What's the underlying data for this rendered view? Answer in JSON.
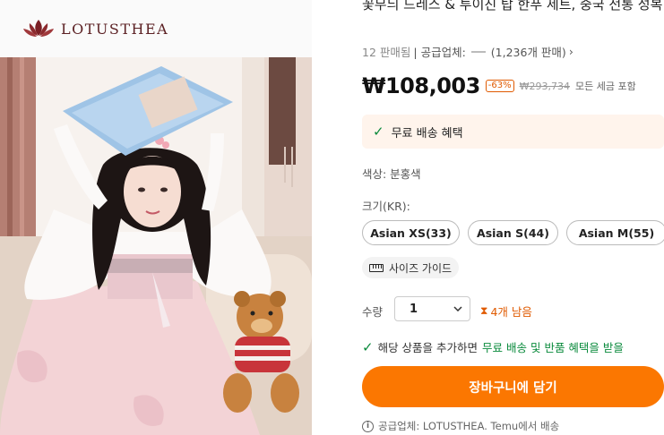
{
  "brand": {
    "name": "LOTUSTHEA"
  },
  "product": {
    "title": "꽃무늬 드레스 & 투이진 탑 한푸 세트, 중국 전통 성복",
    "sold": "12 판매됨",
    "supplier_prefix": "| 공급업체:",
    "supplier_count": "(1,236개 판매)",
    "price": "₩108,003",
    "discount": "-63%",
    "original_price": "₩293,734",
    "tax_note": "모든 세금 포함",
    "shipping_benefit": "무료 배송 혜택",
    "color": "색상: 분홍색",
    "size_label": "크기(KR):",
    "sizes": [
      "Asian XS(33)",
      "Asian S(44)",
      "Asian M(55)"
    ],
    "size_guide": "사이즈 가이드",
    "qty_label": "수량",
    "qty_value": "1",
    "stock": "4개 남음",
    "promo_prefix": "해당 상품을 추가하면",
    "promo_highlight": "무료 배송 및 반품 혜택을 받을",
    "cart_button": "장바구니에 담기",
    "seller_note": "공급업체: LOTUSTHEA. Temu에서 배송"
  },
  "icons": {
    "logo": "lotus-logo-icon",
    "check": "check-icon",
    "ruler": "ruler-icon",
    "chevron": "chevron-down-icon",
    "hourglass": "hourglass-icon",
    "info": "info-icon",
    "arrow": "chevron-right-icon"
  },
  "colors": {
    "accent": "#fb7701",
    "success": "#0a8a3c",
    "warning": "#e05a00",
    "brand": "#5a1f22"
  }
}
